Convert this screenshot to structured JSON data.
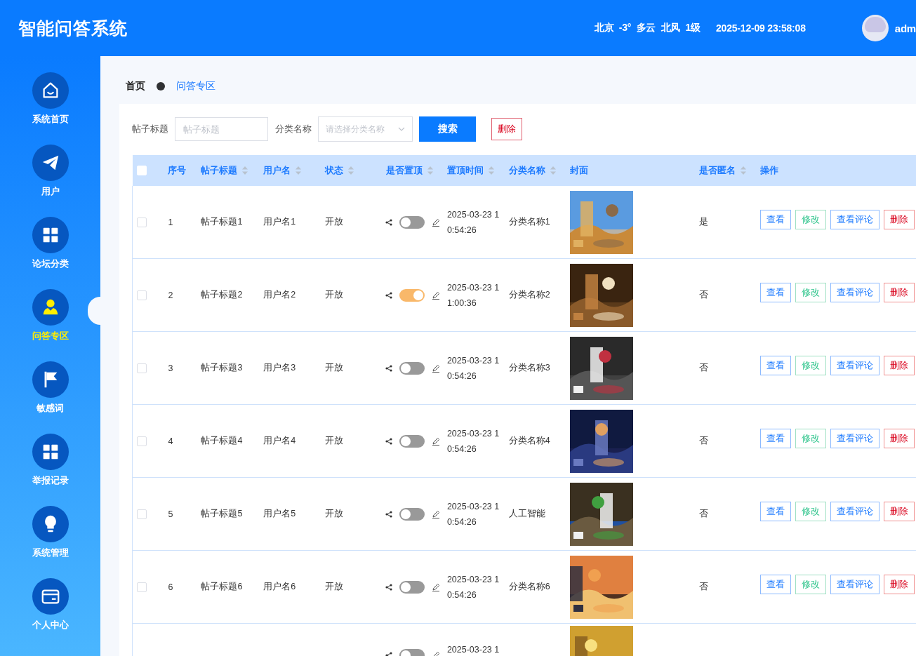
{
  "header": {
    "title": "智能问答系统",
    "weather": "北京  -3°  多云  北风  1级",
    "datetime": "2025-12-09 23:58:08",
    "username": "adm"
  },
  "sidebar": {
    "items": [
      {
        "label": "系统首页",
        "selected": false
      },
      {
        "label": "用户",
        "selected": false
      },
      {
        "label": "论坛分类",
        "selected": false
      },
      {
        "label": "问答专区",
        "selected": true
      },
      {
        "label": "敏感词",
        "selected": false
      },
      {
        "label": "举报记录",
        "selected": false
      },
      {
        "label": "系统管理",
        "selected": false
      },
      {
        "label": "个人中心",
        "selected": false
      }
    ]
  },
  "breadcrumb": [
    {
      "label": "首页",
      "kind": "home"
    },
    {
      "label": "问答专区",
      "kind": "link"
    }
  ],
  "search": {
    "fields": [
      {
        "label": "帖子标题",
        "placeholder": "帖子标题",
        "kind": "input"
      },
      {
        "label": "分类名称",
        "placeholder": "请选择分类名称",
        "kind": "select"
      }
    ],
    "search_button": "搜索",
    "delete_button": "删除"
  },
  "table": {
    "columns": [
      {
        "label": "序号",
        "sortable": false
      },
      {
        "label": "帖子标题",
        "sortable": true
      },
      {
        "label": "用户名",
        "sortable": true
      },
      {
        "label": "状态",
        "sortable": true
      },
      {
        "label": "是否置顶",
        "sortable": true
      },
      {
        "label": "置顶时间",
        "sortable": true
      },
      {
        "label": "分类名称",
        "sortable": true
      },
      {
        "label": "封面",
        "sortable": false
      },
      {
        "label": "是否匿名",
        "sortable": true
      },
      {
        "label": "操作",
        "sortable": false
      }
    ],
    "select_all_checked": false,
    "rows": [
      {
        "checked": false,
        "actions": [
          {
            "label": "查看",
            "kind": "view"
          },
          {
            "label": "修改",
            "kind": "edit"
          },
          {
            "label": "查看评论",
            "kind": "view"
          },
          {
            "label": "删除",
            "kind": "delete"
          }
        ],
        "index": "1",
        "title": "帖子标题1",
        "username": "用户名1",
        "status": "开放",
        "pinned": false,
        "pinned_time": "2025-03-23 10:54:26",
        "category": "分类名称1",
        "anonymous": "是"
      },
      {
        "checked": false,
        "actions": [
          {
            "label": "查看",
            "kind": "view"
          },
          {
            "label": "修改",
            "kind": "edit"
          },
          {
            "label": "查看评论",
            "kind": "view"
          },
          {
            "label": "删除",
            "kind": "delete"
          }
        ],
        "index": "2",
        "title": "帖子标题2",
        "username": "用户名2",
        "status": "开放",
        "pinned": true,
        "pinned_time": "2025-03-23 11:00:36",
        "category": "分类名称2",
        "anonymous": "否"
      },
      {
        "checked": false,
        "actions": [
          {
            "label": "查看",
            "kind": "view"
          },
          {
            "label": "修改",
            "kind": "edit"
          },
          {
            "label": "查看评论",
            "kind": "view"
          },
          {
            "label": "删除",
            "kind": "delete"
          }
        ],
        "index": "3",
        "title": "帖子标题3",
        "username": "用户名3",
        "status": "开放",
        "pinned": false,
        "pinned_time": "2025-03-23 10:54:26",
        "category": "分类名称3",
        "anonymous": "否"
      },
      {
        "checked": false,
        "actions": [
          {
            "label": "查看",
            "kind": "view"
          },
          {
            "label": "修改",
            "kind": "edit"
          },
          {
            "label": "查看评论",
            "kind": "view"
          },
          {
            "label": "删除",
            "kind": "delete"
          }
        ],
        "index": "4",
        "title": "帖子标题4",
        "username": "用户名4",
        "status": "开放",
        "pinned": false,
        "pinned_time": "2025-03-23 10:54:26",
        "category": "分类名称4",
        "anonymous": "否"
      },
      {
        "checked": false,
        "actions": [
          {
            "label": "查看",
            "kind": "view"
          },
          {
            "label": "修改",
            "kind": "edit"
          },
          {
            "label": "查看评论",
            "kind": "view"
          },
          {
            "label": "删除",
            "kind": "delete"
          }
        ],
        "index": "5",
        "title": "帖子标题5",
        "username": "用户名5",
        "status": "开放",
        "pinned": false,
        "pinned_time": "2025-03-23 10:54:26",
        "category": "人工智能",
        "anonymous": "否"
      },
      {
        "checked": false,
        "actions": [
          {
            "label": "查看",
            "kind": "view"
          },
          {
            "label": "修改",
            "kind": "edit"
          },
          {
            "label": "查看评论",
            "kind": "view"
          },
          {
            "label": "删除",
            "kind": "delete"
          }
        ],
        "index": "6",
        "title": "帖子标题6",
        "username": "用户名6",
        "status": "开放",
        "pinned": false,
        "pinned_time": "2025-03-23 10:54:26",
        "category": "分类名称6",
        "anonymous": "否"
      },
      {
        "pinned": false,
        "pinned_time": "2025-03-23 1"
      }
    ]
  }
}
